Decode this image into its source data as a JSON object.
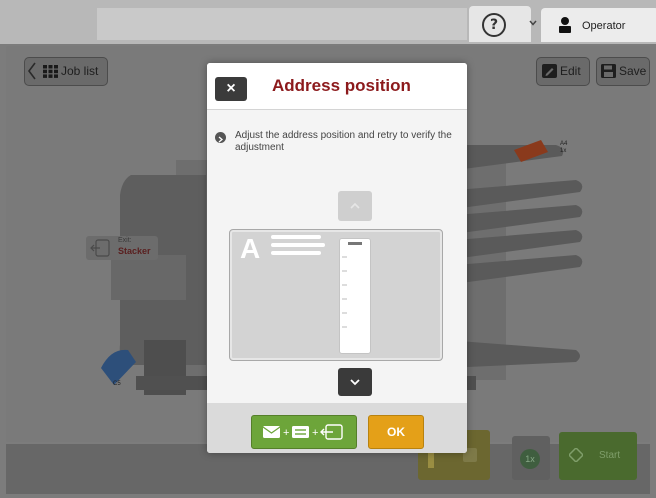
{
  "topbar": {
    "help_icon": "?",
    "user_label": "Operator"
  },
  "toolbar": {
    "job_list_label": "Job list",
    "edit_label": "Edit",
    "save_label": "Save"
  },
  "machine": {
    "exit_label": "Exit:",
    "exit_value": "Stacker",
    "envelope_label": "C5",
    "tray_label": "A4",
    "tray_count": "1x"
  },
  "bottom": {
    "count_label": "1x",
    "start_label": "Start"
  },
  "dialog": {
    "title": "Address position",
    "close_icon": "×",
    "instruction": "Adjust the address position and retry to verify the adjustment",
    "preview_letter": "A",
    "ok_label": "OK"
  },
  "colors": {
    "title_red": "#8c1a1c",
    "flow_green": "#6da53a",
    "ok_orange": "#e4a018",
    "start_green": "#5d9433"
  }
}
